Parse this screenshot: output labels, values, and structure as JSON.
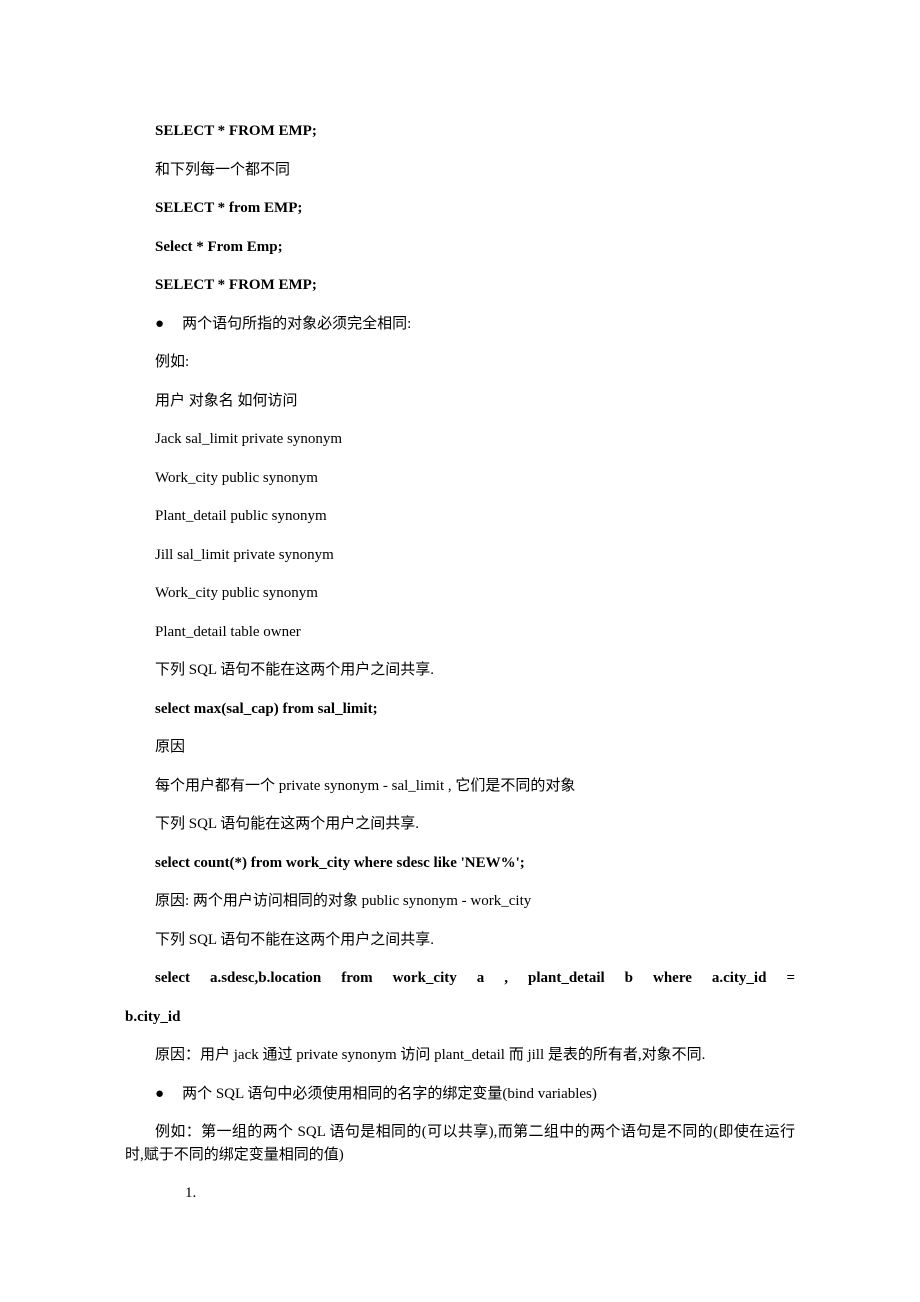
{
  "lines": {
    "l1": "SELECT * FROM EMP;",
    "l2": "和下列每一个都不同",
    "l3": "SELECT * from EMP;",
    "l4": "Select * From Emp;",
    "l5": "SELECT * FROM EMP;",
    "bullet1": "两个语句所指的对象必须完全相同:",
    "l6": "例如:",
    "l7": "用户 对象名 如何访问",
    "l8": "Jack sal_limit private synonym",
    "l9": "Work_city public synonym",
    "l10": "Plant_detail public synonym",
    "l11": "Jill sal_limit private synonym",
    "l12": "Work_city public synonym",
    "l13": "Plant_detail table owner",
    "l14": "下列 SQL 语句不能在这两个用户之间共享.",
    "l15": "select max(sal_cap) from sal_limit;",
    "l16": "原因",
    "l17": "每个用户都有一个 private synonym - sal_limit , 它们是不同的对象",
    "l18": "下列 SQL 语句能在这两个用户之间共享.",
    "l19": "select count(*) from work_city where sdesc like 'NEW%';",
    "l20": "原因: 两个用户访问相同的对象 public synonym - work_city",
    "l21": "下列 SQL 语句不能在这两个用户之间共享.",
    "l22a": "select a.sdesc,b.location from work_city a , plant_detail b where a.city_id =",
    "l22b": "b.city_id",
    "l23": "原因：用户 jack 通过 private synonym 访问 plant_detail 而 jill 是表的所有者,对象不同.",
    "bullet2": "两个 SQL 语句中必须使用相同的名字的绑定变量(bind variables)",
    "l24": "例如：第一组的两个 SQL 语句是相同的(可以共享),而第二组中的两个语句是不同的(即使在运行时,赋于不同的绑定变量相同的值)",
    "num1": "1."
  }
}
